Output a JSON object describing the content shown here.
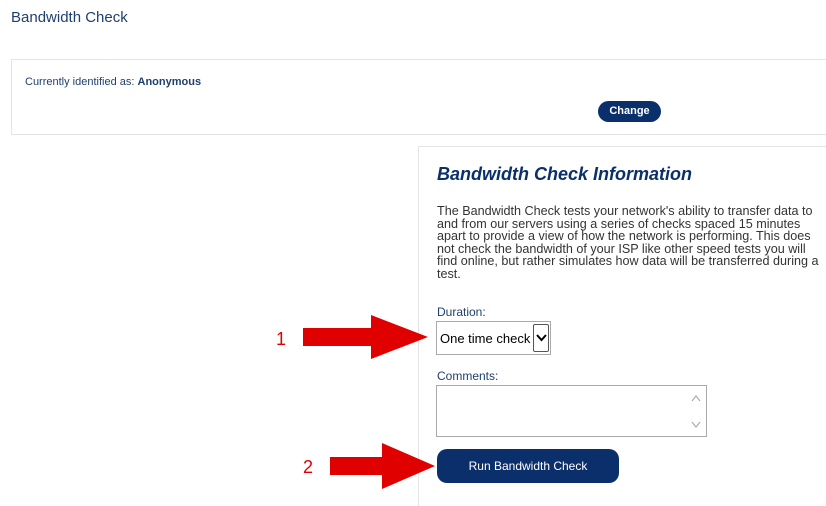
{
  "page": {
    "title": "Bandwidth Check"
  },
  "identity": {
    "label": "Currently identified as:",
    "name": "Anonymous",
    "change_label": "Change"
  },
  "info": {
    "title": "Bandwidth Check Information",
    "description": "The Bandwidth Check tests your network's ability to transfer data to and from our servers using a series of checks spaced 15 minutes apart to provide a view of how the network is performing. This does not check the bandwidth of your ISP like other speed tests you will find online, but rather simulates how data will be transferred during a test.",
    "duration_label": "Duration:",
    "duration_value": "One time check",
    "comments_label": "Comments:",
    "comments_value": "",
    "run_label": "Run Bandwidth Check"
  },
  "annotations": {
    "step1": "1",
    "step2": "2",
    "arrow_color": "#e00000"
  },
  "colors": {
    "brand_navy": "#0b2f6b",
    "label_blue": "#1f3f6e"
  }
}
